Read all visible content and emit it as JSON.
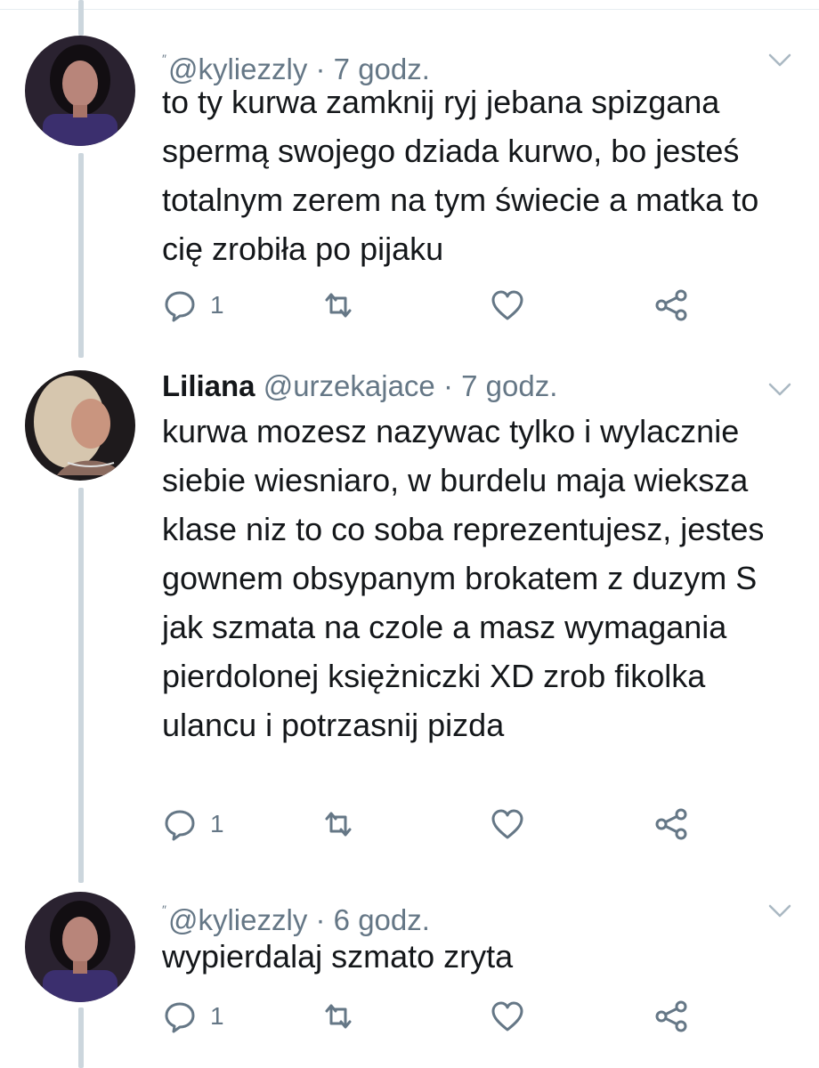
{
  "tweets": [
    {
      "display_name": "",
      "handle": "@kyliezzly",
      "separator": "·",
      "time": "7 godz.",
      "text": "to ty kurwa zamknij ryj jebana spizgana spermą swojego dziada kurwo, bo jesteś totalnym zerem na tym świecie a matka to cię zrobiła po pijaku",
      "reply_count": "1",
      "avatar_icon": "avatar-dark-hair-purple-top"
    },
    {
      "display_name": "Liliana",
      "handle": "@urzekajace",
      "separator": "·",
      "time": "7 godz.",
      "text": "kurwa mozesz nazywac tylko i wylacznie siebie wiesniaro, w burdelu maja wieksza klase niz to co soba reprezentujesz, jestes gownem obsypanym brokatem z duzym S jak szmata na czole a masz wymagania pierdolonej księżniczki XD zrob fikolka ulancu i potrzasnij pizda",
      "reply_count": "1",
      "avatar_icon": "avatar-blonde-hair"
    },
    {
      "display_name": "",
      "handle": "@kyliezzly",
      "separator": "·",
      "time": "6 godz.",
      "text": "wypierdalaj szmato zryta",
      "reply_count": "1",
      "avatar_icon": "avatar-dark-hair-purple-top"
    }
  ],
  "colors": {
    "text": "#14171a",
    "secondary": "#657786",
    "thread_line": "#ccd6dd",
    "divider": "#e6ecf0"
  },
  "icons": [
    "reply-icon",
    "retweet-icon",
    "like-icon",
    "share-icon",
    "chevron-down-icon",
    "verified-tick-icon"
  ]
}
